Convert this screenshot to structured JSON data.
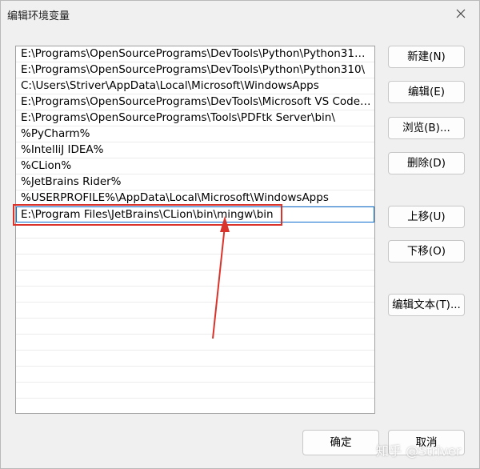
{
  "window": {
    "title": "编辑环境变量"
  },
  "paths": [
    "E:\\Programs\\OpenSourcePrograms\\DevTools\\Python\\Python310\\...",
    "E:\\Programs\\OpenSourcePrograms\\DevTools\\Python\\Python310\\",
    "C:\\Users\\Striver\\AppData\\Local\\Microsoft\\WindowsApps",
    "E:\\Programs\\OpenSourcePrograms\\DevTools\\Microsoft VS Code\\...",
    "E:\\Programs\\OpenSourcePrograms\\Tools\\PDFtk Server\\bin\\",
    "%PyCharm%",
    "%IntelliJ IDEA%",
    "%CLion%",
    "%JetBrains Rider%",
    "%USERPROFILE%\\AppData\\Local\\Microsoft\\WindowsApps",
    "E:\\Program Files\\JetBrains\\CLion\\bin\\mingw\\bin"
  ],
  "buttons": {
    "new": "新建(N)",
    "edit": "编辑(E)",
    "browse": "浏览(B)...",
    "delete": "删除(D)",
    "move_up": "上移(U)",
    "move_down": "下移(O)",
    "edit_text": "编辑文本(T)...",
    "ok": "确定",
    "cancel": "取消"
  },
  "watermark": "知乎 @Striver",
  "colors": {
    "annotation_red": "#d9332b",
    "selection_blue": "#0b6cd0"
  },
  "icons": {
    "close": "close-icon"
  }
}
